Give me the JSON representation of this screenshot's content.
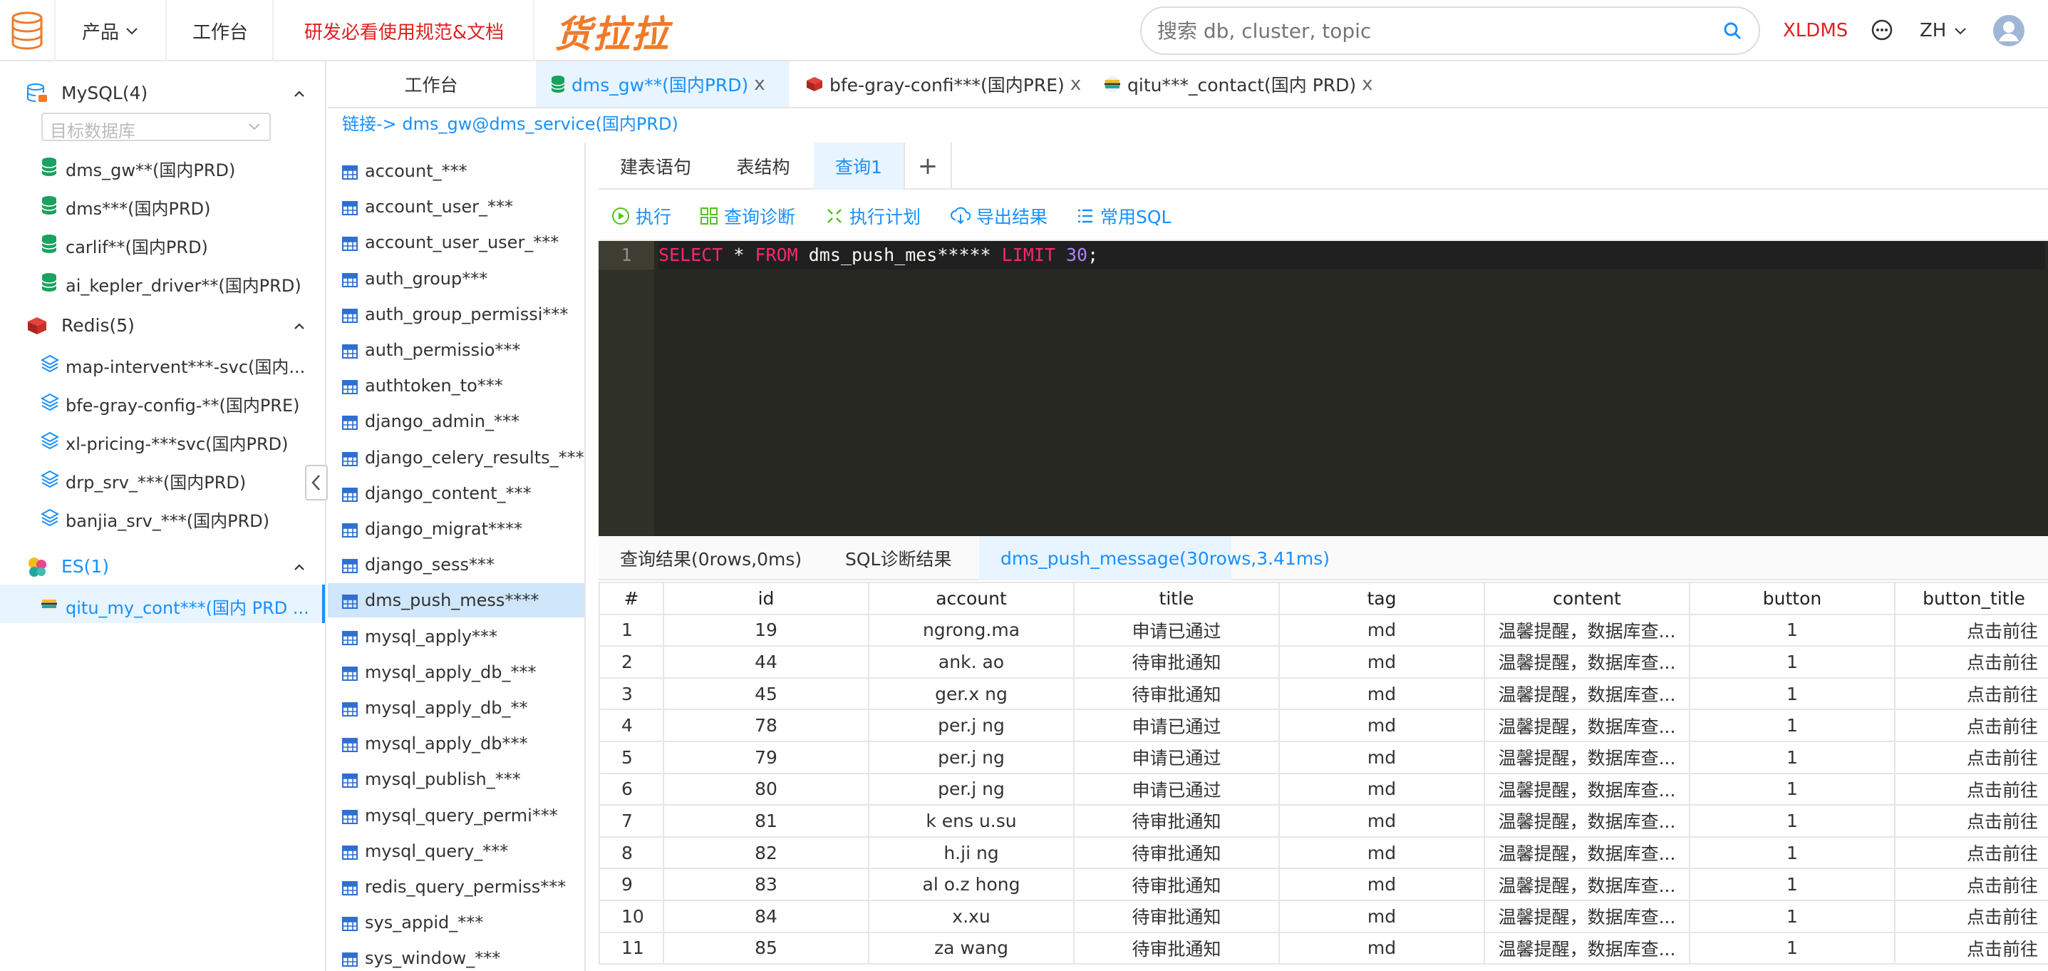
{
  "header": {
    "nav": {
      "products": "产品",
      "workbench": "工作台",
      "guide": "研发必看使用规范&文档"
    },
    "brand": "货拉拉",
    "search_placeholder": "搜索 db, cluster, topic",
    "user_link": "XLDMS",
    "lang": "ZH"
  },
  "sidebar": {
    "db_select_placeholder": "目标数据库",
    "groups": [
      {
        "label": "MySQL(4)",
        "items": [
          "dms_gw**(国内PRD)",
          "dms***(国内PRD)",
          "carlif**(国内PRD)",
          "ai_kepler_driver**(国内PRD)"
        ]
      },
      {
        "label": "Redis(5)",
        "items": [
          "map-intervent***-svc(国内...",
          "bfe-gray-config-**(国内PRE)",
          "xl-pricing-***svc(国内PRD)",
          "drp_srv_***(国内PRD)",
          "banjia_srv_***(国内PRD)"
        ]
      },
      {
        "label": "ES(1)",
        "items": [
          "qitu_my_cont***(国内 PRD ..."
        ]
      }
    ],
    "colors": {
      "mysql": "#1aa260",
      "redis": "#c8302a",
      "active": "#1890ff"
    }
  },
  "tabs": [
    {
      "label": "工作台",
      "closable": false
    },
    {
      "label": "dms_gw**(国内PRD)",
      "closable": true,
      "active": true
    },
    {
      "label": "bfe-gray-confi***(国内PRE)",
      "closable": true
    },
    {
      "label": "qitu***_contact(国内 PRD)",
      "closable": true
    }
  ],
  "close_glyph": "x",
  "breadcrumb": "链接-> dms_gw@dms_service(国内PRD)",
  "tables": [
    "account_***",
    "account_user_***",
    "account_user_user_***",
    "auth_group***",
    "auth_group_permissi***",
    "auth_permissio***",
    "authtoken_to***",
    "django_admin_***",
    "django_celery_results_****",
    "django_content_***",
    "django_migrat****",
    "django_sess***",
    "dms_push_mess****",
    "mysql_apply***",
    "mysql_apply_db_***",
    "mysql_apply_db_**",
    "mysql_apply_db***",
    "mysql_publish_***",
    "mysql_query_permi***",
    "mysql_query_***",
    "redis_query_permiss***",
    "sys_appid_***",
    "sys_window_***"
  ],
  "active_table_index": 12,
  "subtabs": [
    "建表语句",
    "表结构",
    "查询1"
  ],
  "add_tab_glyph": "+",
  "toolbar": {
    "run": "执行",
    "diagnose": "查询诊断",
    "plan": "执行计划",
    "export": "导出结果",
    "common_sql": "常用SQL"
  },
  "editor": {
    "line_number": "1",
    "sql": {
      "kw1": "SELECT",
      "star": " * ",
      "kw2": "FROM",
      "table": " dms_push_mes***** ",
      "kw3": "LIMIT",
      "space": " ",
      "num": "30",
      "end": ";"
    }
  },
  "result_tabs": [
    "查询结果(0rows,0ms)",
    "SQL诊断结果",
    "dms_push_message(30rows,3.41ms)"
  ],
  "grid": {
    "columns": [
      "#",
      "id",
      "account",
      "title",
      "tag",
      "content",
      "button",
      "button_title"
    ],
    "rows": [
      [
        "1",
        "19",
        "ngrong.ma",
        "申请已通过",
        "md",
        "温馨提醒，数据库查...",
        "1",
        "点击前往"
      ],
      [
        "2",
        "44",
        "ank.  ao",
        "待审批通知",
        "md",
        "温馨提醒，数据库查...",
        "1",
        "点击前往"
      ],
      [
        "3",
        "45",
        "ger.x  ng",
        "待审批通知",
        "md",
        "温馨提醒，数据库查...",
        "1",
        "点击前往"
      ],
      [
        "4",
        "78",
        "per.j  ng",
        "申请已通过",
        "md",
        "温馨提醒，数据库查...",
        "1",
        "点击前往"
      ],
      [
        "5",
        "79",
        "per.j  ng",
        "申请已通过",
        "md",
        "温馨提醒，数据库查...",
        "1",
        "点击前往"
      ],
      [
        "6",
        "80",
        "per.j  ng",
        "申请已通过",
        "md",
        "温馨提醒，数据库查...",
        "1",
        "点击前往"
      ],
      [
        "7",
        "81",
        "k  ens  u.su",
        "待审批通知",
        "md",
        "温馨提醒，数据库查...",
        "1",
        "点击前往"
      ],
      [
        "8",
        "82",
        "h.ji  ng",
        "待审批通知",
        "md",
        "温馨提醒，数据库查...",
        "1",
        "点击前往"
      ],
      [
        "9",
        "83",
        "al  o.z  hong",
        "待审批通知",
        "md",
        "温馨提醒，数据库查...",
        "1",
        "点击前往"
      ],
      [
        "10",
        "84",
        "x.xu",
        "待审批通知",
        "md",
        "温馨提醒，数据库查...",
        "1",
        "点击前往"
      ],
      [
        "11",
        "85",
        "za  wang",
        "待审批通知",
        "md",
        "温馨提醒，数据库查...",
        "1",
        "点击前往"
      ]
    ]
  }
}
